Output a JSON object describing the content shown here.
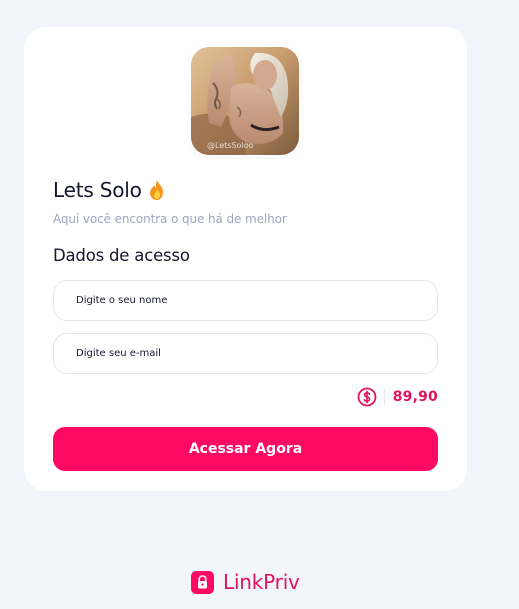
{
  "profile": {
    "avatar_icon": "profile-photo",
    "avatar_watermark": "@LetsSoloo",
    "name": "Lets Solo",
    "name_emoji_icon": "fire-icon",
    "tagline": "Aqui você encontra o que há de melhor"
  },
  "form": {
    "section_title": "Dados de acesso",
    "name_placeholder": "Digite o seu nome",
    "email_placeholder": "Digite seu e-mail"
  },
  "price": {
    "currency_icon": "dollar-coin-icon",
    "value": "89,90"
  },
  "cta": {
    "label": "Acessar Agora"
  },
  "brand": {
    "icon": "lock-icon",
    "name": "LinkPriv"
  },
  "colors": {
    "accent": "#ff0a63",
    "accent_text": "#e0145e",
    "background": "#f3f5fc",
    "card": "#ffffff",
    "muted_text": "#9ea5bf"
  }
}
